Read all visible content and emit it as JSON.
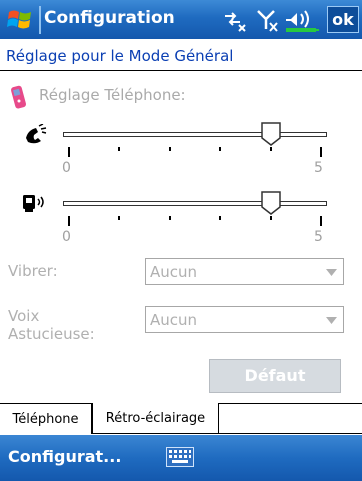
{
  "titlebar": {
    "title": "Configuration",
    "ok_label": "ok",
    "icons": [
      "windows-start-icon",
      "connectivity-icon",
      "signal-off-icon",
      "volume-icon",
      "battery-icon"
    ]
  },
  "page": {
    "heading": "Réglage pour le Mode Général",
    "group_label": "Réglage Téléphone:"
  },
  "sliders": [
    {
      "name": "ringer-volume",
      "icon": "phone-ring-icon",
      "min_label": "0",
      "max_label": "5",
      "min": 0,
      "max": 5,
      "value": 4
    },
    {
      "name": "device-volume",
      "icon": "device-speaker-icon",
      "min_label": "0",
      "max_label": "5",
      "min": 0,
      "max": 5,
      "value": 4
    }
  ],
  "fields": {
    "vibrate": {
      "label": "Vibrer:",
      "value": "Aucun"
    },
    "smart_voice": {
      "label_line1": "Voix",
      "label_line2": "Astucieuse:",
      "value": "Aucun"
    }
  },
  "default_button": "Défaut",
  "tabs": [
    {
      "label": "Téléphone",
      "active": true
    },
    {
      "label": "Rétro-éclairage",
      "active": false
    }
  ],
  "command_bar": {
    "left_label": "Configurat...",
    "keyboard_icon": "keyboard-icon"
  },
  "colors": {
    "titlebar": "#1f6bc0",
    "heading": "#0b3fb3",
    "disabled_text": "#b0b0b0"
  }
}
